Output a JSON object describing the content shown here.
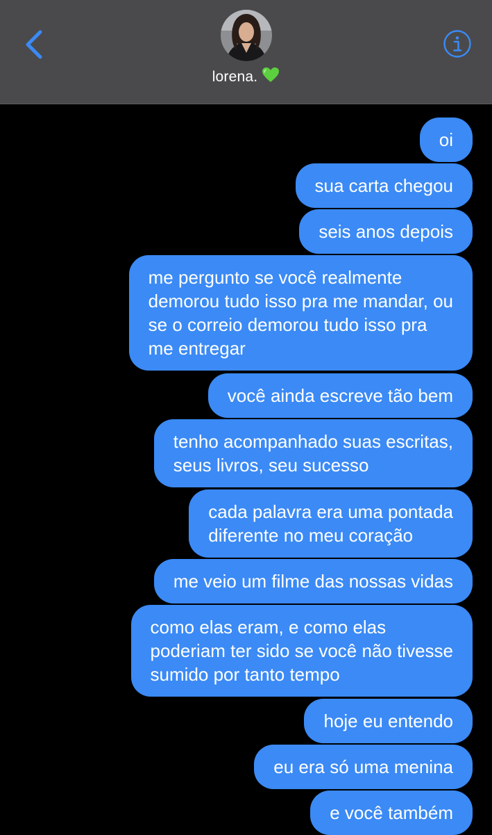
{
  "header": {
    "contact_name": "lorena.",
    "back_icon": "chevron-left-icon",
    "info_icon": "info-circle-icon",
    "accent_color": "#3b8af5"
  },
  "messages": [
    {
      "lines": [
        "oi"
      ]
    },
    {
      "lines": [
        "sua carta chegou"
      ]
    },
    {
      "lines": [
        "seis anos depois"
      ]
    },
    {
      "lines": [
        "me pergunto se você realmente",
        "demorou tudo isso pra me mandar, ou",
        "se o correio demorou tudo isso pra",
        "me entregar"
      ]
    },
    {
      "lines": [
        "você ainda escreve tão bem"
      ]
    },
    {
      "lines": [
        "tenho acompanhado suas escritas,",
        "seus livros, seu sucesso"
      ]
    },
    {
      "lines": [
        "cada palavra era uma pontada",
        "diferente no meu coração"
      ]
    },
    {
      "lines": [
        "me veio um filme das nossas vidas"
      ]
    },
    {
      "lines": [
        "como elas eram, e como elas",
        "poderiam ter sido se você não tivesse",
        "sumido por tanto tempo"
      ]
    },
    {
      "lines": [
        "hoje eu entendo"
      ]
    },
    {
      "lines": [
        "eu era só uma menina"
      ]
    },
    {
      "lines": [
        "e você também"
      ]
    }
  ]
}
